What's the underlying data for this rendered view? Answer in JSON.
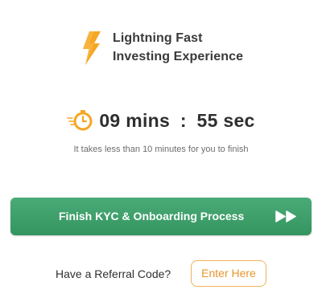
{
  "hero": {
    "icon": "lightning-bolt-icon",
    "headline_line1": "Lightning Fast",
    "headline_line2": "Investing Experience"
  },
  "timer": {
    "icon": "clock-timer-icon",
    "minutes_value": "09",
    "minutes_unit": "mins",
    "separator": ":",
    "seconds_value": "55",
    "seconds_unit": "sec",
    "subtext": "It takes less than 10 minutes for you to finish"
  },
  "cta": {
    "label": "Finish KYC & Onboarding Process",
    "icon": "fast-forward-icon"
  },
  "referral": {
    "prompt": "Have a Referral Code?",
    "button_label": "Enter Here"
  },
  "colors": {
    "accent_orange": "#f5a623",
    "primary_green": "#3d9f6a",
    "text_dark": "#2f2f2f",
    "text_muted": "#6d6d6d"
  }
}
